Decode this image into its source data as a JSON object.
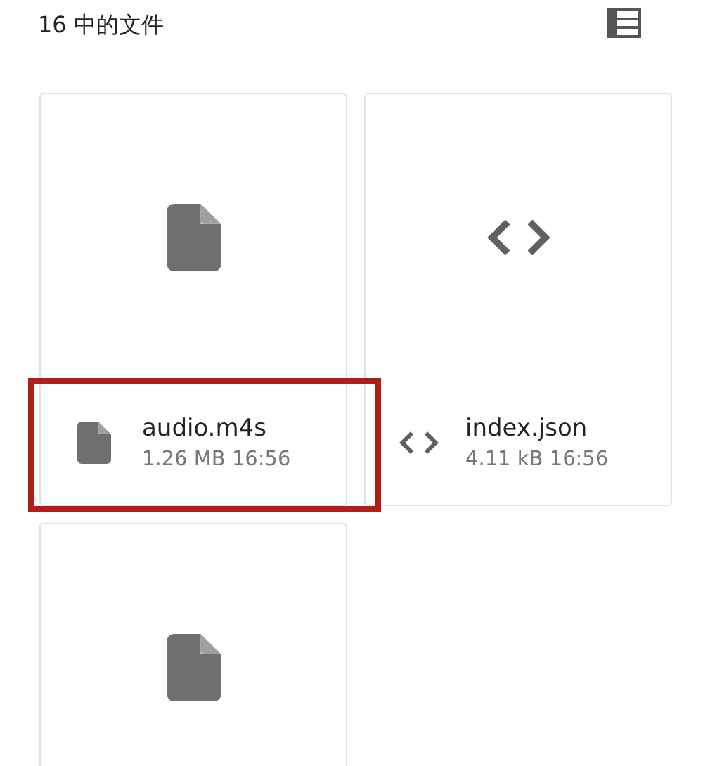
{
  "header": {
    "title": "16 中的文件"
  },
  "files": [
    {
      "kind": "file",
      "name": "audio.m4s",
      "meta": "1.26 MB 16:56",
      "highlighted": true
    },
    {
      "kind": "code",
      "name": "index.json",
      "meta": "4.11 kB 16:56",
      "highlighted": false
    },
    {
      "kind": "file",
      "highlighted": false
    }
  ]
}
